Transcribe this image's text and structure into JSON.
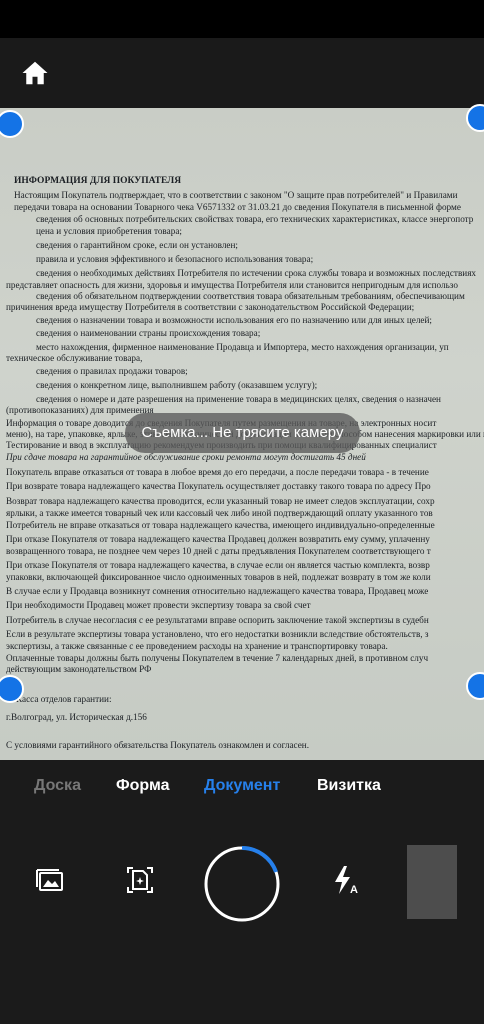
{
  "toast": "Съемка... Не трясите камеру",
  "modes": [
    "Доска",
    "Форма",
    "Документ",
    "Визитка"
  ],
  "active_mode": "Документ",
  "icons": {
    "home": "home-icon",
    "gallery": "image-gallery-icon",
    "auto_capture": "auto-capture-icon",
    "flash": "flash-auto-icon"
  },
  "colors": {
    "accent": "#2680eb",
    "handle": "#1473e6",
    "background": "#1b1b1b"
  },
  "document": {
    "title": "ИНФОРМАЦИЯ ДЛЯ ПОКУПАТЕЛЯ",
    "lines": [
      "Настоящим Покупатель подтверждает, что в соответствии с законом \"О защите прав потребителей\" и Правилами",
      "передачи товара на основании Товарного чека V6571332 от 31.03.21 до сведения Покупателя в письменной форме",
      "сведения об основных потребительских свойствах товара, его технических характеристиках, классе энергопотр",
      "цена и условия приобретения товара;",
      "сведения о гарантийном сроке, если он установлен;",
      "правила и условия эффективного и безопасного использования товара;",
      "сведения о необходимых действиях Потребителя по истечении срока службы товара и возможных последствиях",
      "представляет опасность для жизни, здоровья и имущества Потребителя или становится непригодным для использо",
      "сведения об обязательном подтверждении соответствия товара обязательным требованиям, обеспечивающим",
      "причинения вреда имуществу Потребителя в соответствии с законодательством Российской Федерации;",
      "сведения о назначении товара и возможности использования его по назначению или для иных целей;",
      "сведения о наименовании страны происхождения товара;",
      "место нахождения, фирменное наименование Продавца и Импортера, место нахождения организации, уп",
      "техническое обслуживание товара,",
      "сведения о правилах продажи товаров;",
      "сведения о конкретном лице, выполнившем работу (оказавшем услугу);",
      "сведения о номере и дате разрешения на применение товара в медицинских целях, сведения о назначен",
      "(противопоказаниях) для применения",
      "Информация о товаре доводится до сведения Покупателя путем размещения на товаре, на электронных носит",
      "меню), на таре, упаковке, ярлыке, этикетке, в технической документации или иным способом нанесения маркировки или и",
      "Тестирование и ввод в эксплуатацию рекомендуем производить при помощи квалифицированных специалист",
      "При сдаче товара на гарантийное обслуживание сроки ремонта могут достигать 45 дней",
      "Покупатель вправе отказаться от товара в любое время до его передачи, а после передачи товара - в течение",
      "При возврате товара надлежащего качества Покупатель осуществляет доставку такого товара по адресу Про",
      "Возврат товара надлежащего качества проводится, если указанный товар не имеет следов эксплуатации, сохр",
      "ярлыки, а также имеется товарный чек или кассовый чек либо иной подтверждающий оплату указанного тов",
      "Потребитель не вправе отказаться от товара надлежащего качества, имеющего индивидуально-определенные",
      "При отказе Покупателя от товара надлежащего качества Продавец должен возвратить ему сумму, уплаченну",
      "возвращенного товара, не позднее чем через 10 дней с даты предъявления Покупателем соответствующего т",
      "При отказе Покупателя от товара надлежащего качества, в случае если он является частью комплекта, возвр",
      "упаковки, включающей фиксированное число одноименных товаров в ней, подлежат возврату в том же коли",
      "В случае если у Продавца возникнут сомнения относительно надлежащего качества товара, Продавец може",
      "При необходимости Продавец может провести экспертизу товара за свой счет",
      "Потребитель в случае несогласия с ее результатами вправе оспорить заключение такой экспертизы в судебн",
      "Если в результате экспертизы товара установлено, что его недостатки возникли вследствие обстоятельств, з",
      "экспертизы, а также связанные с ее проведением расходы на хранение и транспортировку товара.",
      "Оплаченные товары должны быть получены Покупателем в течение 7 календарных дней, в противном случ",
      "действующим законодательством РФ",
      "Касса отделов гарантии:",
      "г.Волгоград, ул. Историческая д.156",
      "С условиями гарантийного обязательства Покупатель ознакомлен и согласен."
    ]
  }
}
